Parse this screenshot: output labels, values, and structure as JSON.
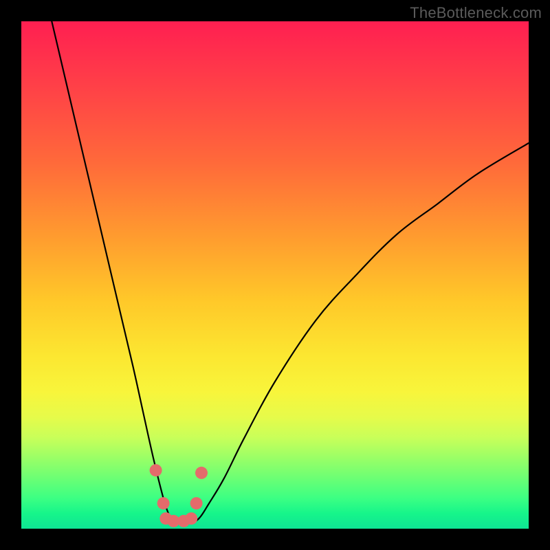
{
  "watermark": "TheBottleneck.com",
  "chart_data": {
    "type": "line",
    "title": "",
    "xlabel": "",
    "ylabel": "",
    "xlim": [
      0,
      100
    ],
    "ylim": [
      0,
      100
    ],
    "gradient_stops": [
      {
        "pos": 0,
        "color": "#ff1f51"
      },
      {
        "pos": 28,
        "color": "#ff6a3a"
      },
      {
        "pos": 55,
        "color": "#ffc829"
      },
      {
        "pos": 73,
        "color": "#f8f53b"
      },
      {
        "pos": 90,
        "color": "#6cff74"
      },
      {
        "pos": 100,
        "color": "#0ee494"
      }
    ],
    "series": [
      {
        "name": "bottleneck-curve",
        "x": [
          6,
          10,
          14,
          18,
          22,
          24,
          26,
          28,
          29,
          30,
          31,
          33,
          35,
          37,
          40,
          44,
          50,
          58,
          66,
          74,
          82,
          90,
          100
        ],
        "values": [
          100,
          83,
          66,
          49,
          32,
          23,
          14,
          6,
          3,
          1,
          1,
          1,
          2,
          5,
          10,
          18,
          29,
          41,
          50,
          58,
          64,
          70,
          76
        ]
      }
    ],
    "markers": {
      "name": "highlight-dots",
      "color": "#e46b6b",
      "x": [
        26.5,
        28.0,
        28.5,
        30.0,
        32.0,
        33.5,
        34.5,
        35.5
      ],
      "values": [
        11.5,
        5.0,
        2.0,
        1.5,
        1.5,
        2.0,
        5.0,
        11.0
      ]
    }
  }
}
